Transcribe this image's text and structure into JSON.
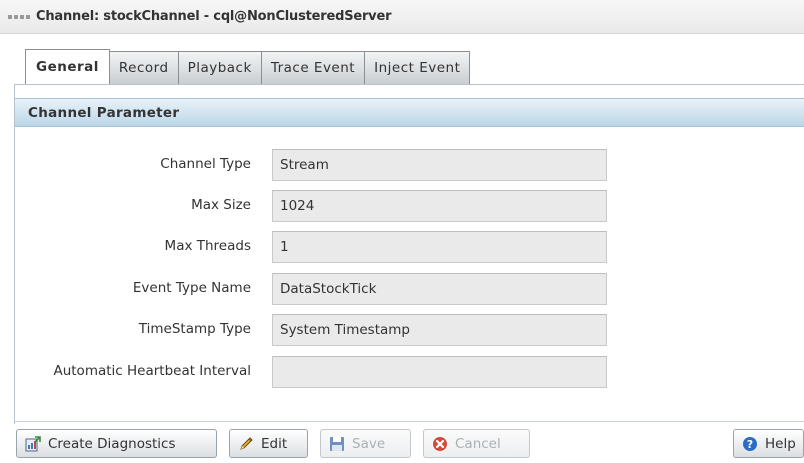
{
  "window": {
    "title": "Channel: stockChannel - cql@NonClusteredServer"
  },
  "tabs": [
    {
      "label": "General",
      "active": true
    },
    {
      "label": "Record",
      "active": false
    },
    {
      "label": "Playback",
      "active": false
    },
    {
      "label": "Trace Event",
      "active": false
    },
    {
      "label": "Inject Event",
      "active": false
    }
  ],
  "section": {
    "title": "Channel Parameter"
  },
  "fields": [
    {
      "label": "Channel Type",
      "value": "Stream"
    },
    {
      "label": "Max Size",
      "value": "1024"
    },
    {
      "label": "Max Threads",
      "value": "1"
    },
    {
      "label": "Event Type Name",
      "value": "DataStockTick"
    },
    {
      "label": "TimeStamp Type",
      "value": "System Timestamp"
    },
    {
      "label": "Automatic Heartbeat Interval",
      "value": ""
    }
  ],
  "buttons": {
    "create_diagnostics": "Create Diagnostics",
    "edit": "Edit",
    "save": "Save",
    "cancel": "Cancel",
    "help": "Help"
  },
  "icons": {
    "create_diagnostics": "diagnostics-icon",
    "edit": "pencil-icon",
    "save": "floppy-disk-icon",
    "cancel": "cancel-x-icon",
    "help": "help-question-icon"
  },
  "colors": {
    "header_gradient_top": "#e8f2f9",
    "header_gradient_bottom": "#bcd6e8",
    "field_background": "#eaeaea",
    "help_blue": "#2b6cc4",
    "cancel_red": "#d24b3c"
  }
}
